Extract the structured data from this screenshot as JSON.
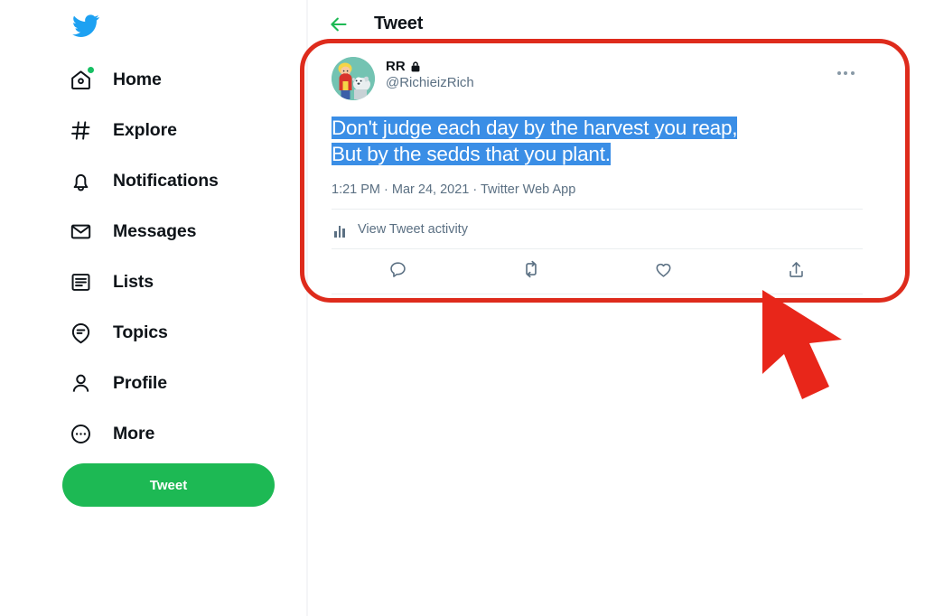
{
  "theme": {
    "brand_blue": "#1da1f2",
    "accent_green": "#1db954",
    "annotation_red": "#de2b1c",
    "selection_blue": "#3a8ee6",
    "text_primary": "#0f1419",
    "text_secondary": "#5b7083"
  },
  "sidebar": {
    "logo_icon": "twitter-bird-icon",
    "items": [
      {
        "label": "Home",
        "icon": "home-icon",
        "badge_dot": true
      },
      {
        "label": "Explore",
        "icon": "hashtag-icon",
        "badge_dot": false
      },
      {
        "label": "Notifications",
        "icon": "bell-icon",
        "badge_dot": false
      },
      {
        "label": "Messages",
        "icon": "envelope-icon",
        "badge_dot": false
      },
      {
        "label": "Lists",
        "icon": "list-icon",
        "badge_dot": false
      },
      {
        "label": "Topics",
        "icon": "topics-speech-bubble-icon",
        "badge_dot": false
      },
      {
        "label": "Profile",
        "icon": "person-icon",
        "badge_dot": false
      },
      {
        "label": "More",
        "icon": "ellipsis-circle-icon",
        "badge_dot": false
      }
    ],
    "compose_button_label": "Tweet"
  },
  "header": {
    "back_icon": "arrow-left-icon",
    "title": "Tweet"
  },
  "tweet": {
    "avatar_icon": "user-avatar-cartoon-boy-with-dog",
    "author_name": "RR",
    "protected_icon": "lock-icon",
    "author_handle": "@RichieizRich",
    "more_icon": "ellipsis-horizontal-icon",
    "text_selected_line_1": "Don't judge each day by the harvest you reap,",
    "text_selected_line_2": "But by the sedds that you plant.",
    "timestamp": "1:21 PM · Mar 24, 2021 · Twitter Web App",
    "activity_icon": "bar-chart-icon",
    "activity_label": "View Tweet activity",
    "actions": [
      {
        "name": "reply",
        "icon": "reply-speech-bubble-icon"
      },
      {
        "name": "retweet",
        "icon": "retweet-icon"
      },
      {
        "name": "like",
        "icon": "heart-icon"
      },
      {
        "name": "share",
        "icon": "share-upload-icon"
      }
    ]
  },
  "annotations": {
    "highlight_box_icon": "red-rounded-rectangle-highlight",
    "cursor_icon": "red-mouse-cursor-arrow"
  }
}
